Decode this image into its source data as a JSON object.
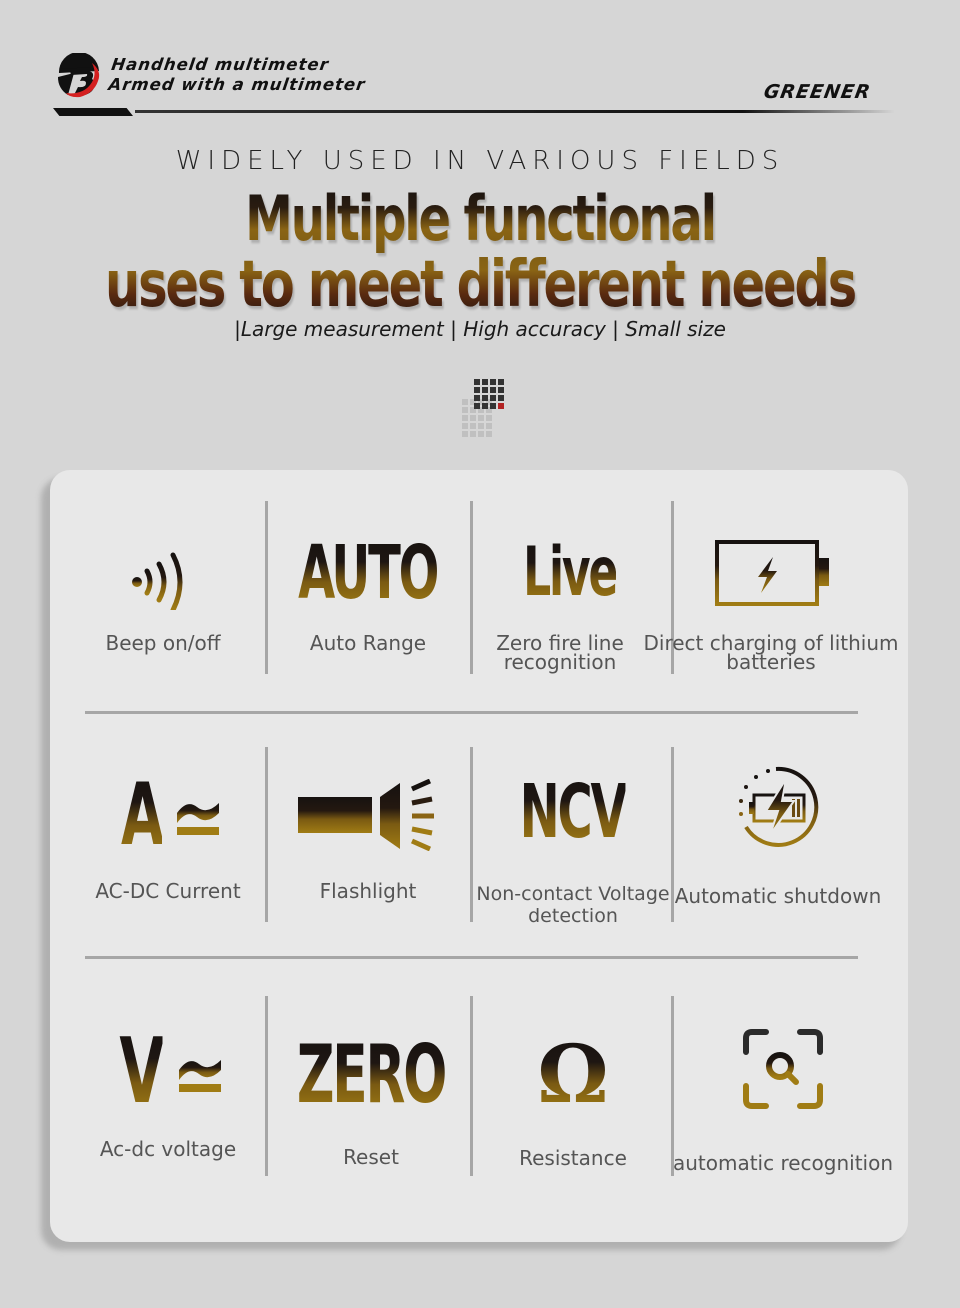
{
  "header": {
    "tagline_line1": "Handheld multimeter",
    "tagline_line2": "Armed with a multimeter",
    "brand": "GREENER",
    "logo_icon": "brand-b-logo"
  },
  "hero": {
    "kicker": "WIDELY USED IN VARIOUS FIELDS",
    "headline_line1": "Multiple functional",
    "headline_line2": "uses to meet different needs",
    "subline": "|Large measurement | High accuracy | Small size",
    "decoration_icon": "pixel-grid-icon"
  },
  "colors": {
    "background": "#d6d6d6",
    "card": "#e8e8e8",
    "gold": "#a07c14",
    "dark": "#161210",
    "label": "#555555",
    "accent_red": "#b22222"
  },
  "features": [
    {
      "icon": "beep-sound-icon",
      "icon_text": "",
      "label": "Beep on/off"
    },
    {
      "icon": "auto-text-icon",
      "icon_text": "AUTO",
      "label": "Auto Range"
    },
    {
      "icon": "live-text-icon",
      "icon_text": "Live",
      "label": "Zero fire line recognition"
    },
    {
      "icon": "battery-charging-icon",
      "icon_text": "",
      "label": "Direct charging of lithium batteries"
    },
    {
      "icon": "ac-dc-current-icon",
      "icon_text": "A",
      "icon_symbol": "≃",
      "label": "AC-DC Current"
    },
    {
      "icon": "flashlight-icon",
      "icon_text": "",
      "label": "Flashlight"
    },
    {
      "icon": "ncv-text-icon",
      "icon_text": "NCV",
      "label": "Non-contact Voltage detection"
    },
    {
      "icon": "auto-shutdown-icon",
      "icon_text": "",
      "label": "Automatic shutdown"
    },
    {
      "icon": "ac-dc-voltage-icon",
      "icon_text": "V",
      "icon_symbol": "≃",
      "label": "Ac-dc voltage"
    },
    {
      "icon": "zero-text-icon",
      "icon_text": "ZERO",
      "label": "Reset"
    },
    {
      "icon": "omega-icon",
      "icon_text": "Ω",
      "label": "Resistance"
    },
    {
      "icon": "scan-search-icon",
      "icon_text": "",
      "label": "automatic recognition"
    }
  ]
}
